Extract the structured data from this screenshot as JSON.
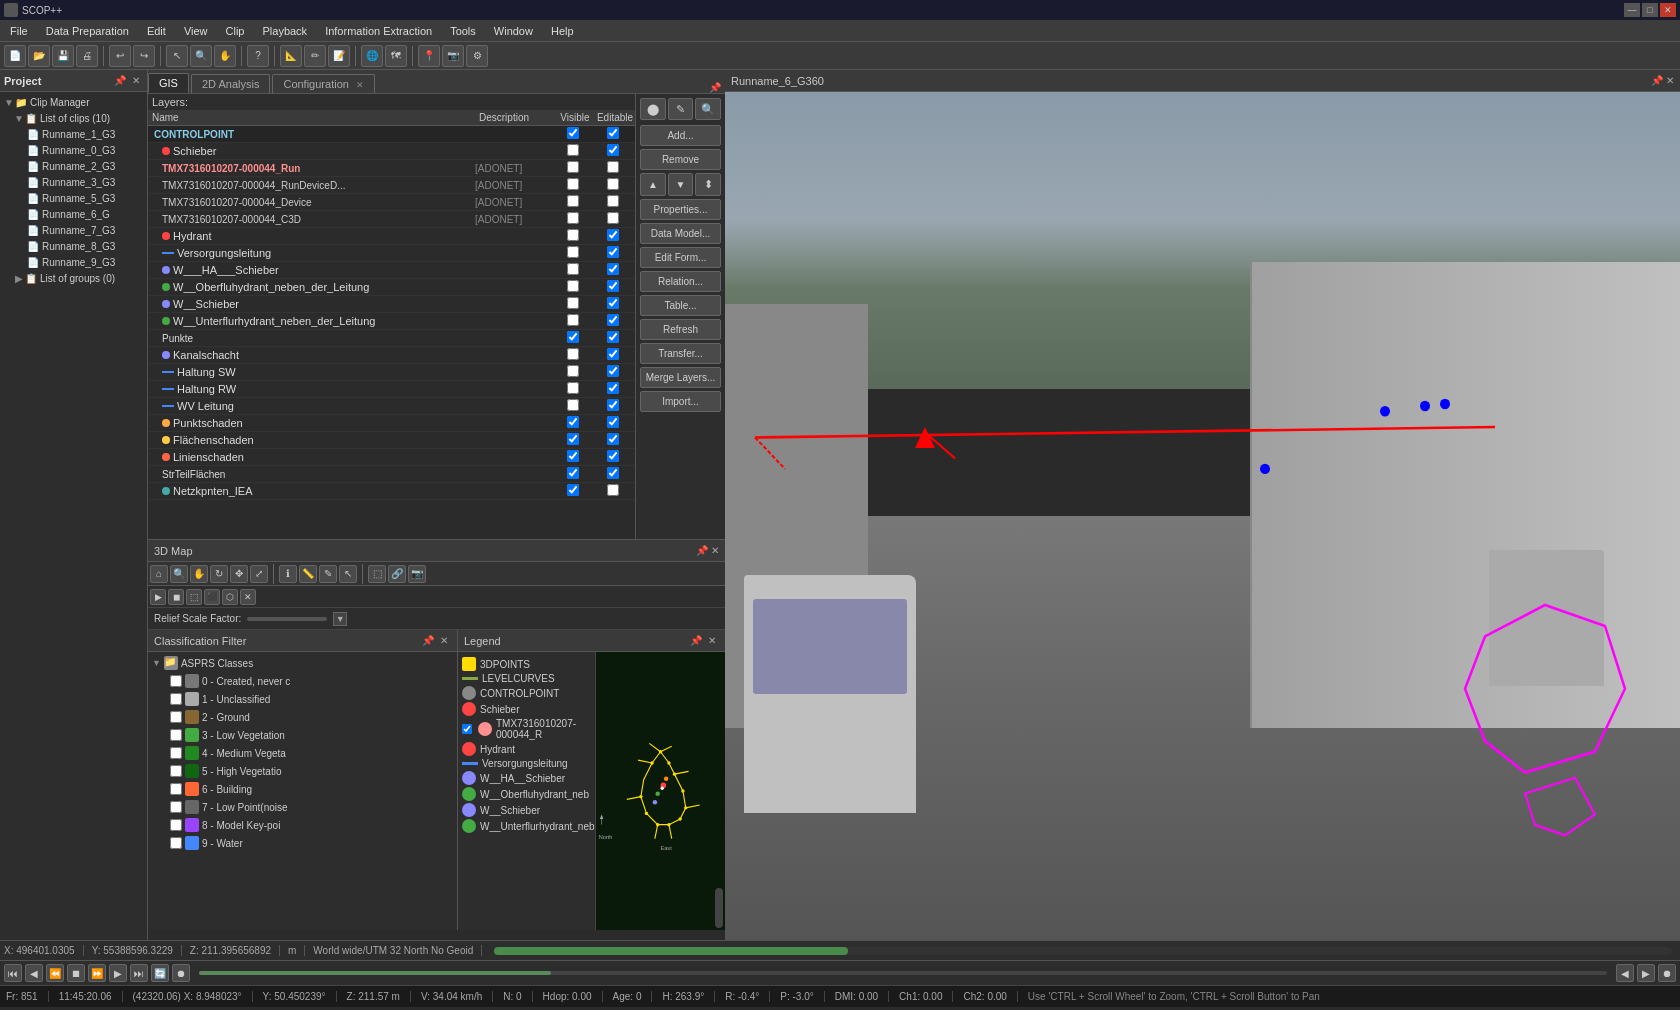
{
  "titlebar": {
    "text": "SCOP++",
    "min": "—",
    "max": "□",
    "close": "✕"
  },
  "menubar": {
    "items": [
      "File",
      "Data Preparation",
      "Edit",
      "View",
      "Clip",
      "Playback",
      "Information Extraction",
      "Tools",
      "Window",
      "Help"
    ]
  },
  "project": {
    "title": "Project",
    "clip_manager": "Clip Manager",
    "list_of_clips": "List of clips (10)",
    "clips": [
      "Runname_1_G3",
      "Runname_0_G3",
      "Runname_2_G3",
      "Runname_3_G3",
      "Runname_5_G3",
      "Runname_6_G",
      "Runname_7_G3",
      "Runname_8_G3",
      "Runname_9_G3"
    ],
    "list_of_groups": "List of groups (0)"
  },
  "gis_tabs": {
    "gis_label": "GIS",
    "analysis_label": "2D Analysis",
    "config_label": "Configuration"
  },
  "layers": {
    "header": "Layers:",
    "cols": {
      "name": "Name",
      "description": "Description",
      "visible": "Visible",
      "editable": "Editable"
    },
    "items": [
      {
        "name": "CONTROLPOINT",
        "desc": "",
        "vis": true,
        "edit": true,
        "color": null,
        "bold": true,
        "category": true
      },
      {
        "name": "Schieber",
        "desc": "",
        "vis": false,
        "edit": true,
        "color": "#ff4444",
        "type": "dot"
      },
      {
        "name": "TMX7316010207-000044_Run",
        "desc": "[ADONET]",
        "vis": false,
        "edit": false,
        "color": "#ff9090",
        "bold": true,
        "type": "bold"
      },
      {
        "name": "TMX7316010207-000044_RunDeviceD...",
        "desc": "[ADONET]",
        "vis": false,
        "edit": false,
        "type": "normal"
      },
      {
        "name": "TMX7316010207-000044_Device",
        "desc": "[ADONET]",
        "vis": false,
        "edit": false,
        "type": "normal"
      },
      {
        "name": "TMX7316010207-000044_C3D",
        "desc": "[ADONET]",
        "vis": false,
        "edit": false,
        "type": "normal"
      },
      {
        "name": "Hydrant",
        "desc": "",
        "vis": false,
        "edit": true,
        "color": "#ff4444",
        "type": "dot"
      },
      {
        "name": "Versorgungsleitung",
        "desc": "",
        "vis": false,
        "edit": true,
        "color": "#4488ff",
        "type": "line"
      },
      {
        "name": "W___HA___Schieber",
        "desc": "",
        "vis": false,
        "edit": true,
        "color": "#8888ff",
        "type": "dot"
      },
      {
        "name": "W__Oberfluhydrant_neben_der_Leitung",
        "desc": "",
        "vis": false,
        "edit": true,
        "color": "#44aa44",
        "type": "dot"
      },
      {
        "name": "W__Schieber",
        "desc": "",
        "vis": false,
        "edit": true,
        "color": "#8888ff",
        "type": "dot"
      },
      {
        "name": "W__Unterflurhydrant_neben_der_Leitung",
        "desc": "",
        "vis": false,
        "edit": true,
        "color": "#44aa44",
        "type": "dot"
      },
      {
        "name": "Punkte",
        "desc": "",
        "vis": true,
        "edit": true,
        "color": null,
        "type": "normal"
      },
      {
        "name": "Kanalschacht",
        "desc": "",
        "vis": false,
        "edit": true,
        "color": "#8888ff",
        "type": "dot"
      },
      {
        "name": "Haltung SW",
        "desc": "",
        "vis": false,
        "edit": true,
        "color": "#4488ff",
        "type": "line"
      },
      {
        "name": "Haltung RW",
        "desc": "",
        "vis": false,
        "edit": true,
        "color": "#4488ff",
        "type": "line"
      },
      {
        "name": "WV Leitung",
        "desc": "",
        "vis": false,
        "edit": true,
        "color": "#4488ff",
        "type": "line"
      },
      {
        "name": "Punktschaden",
        "desc": "",
        "vis": true,
        "edit": true,
        "color": "#ff8844",
        "type": "dot"
      },
      {
        "name": "Flächenschaden",
        "desc": "",
        "vis": true,
        "edit": true,
        "color": "#ffaa44",
        "type": "dot"
      },
      {
        "name": "Linienschaden",
        "desc": "",
        "vis": true,
        "edit": true,
        "color": "#ff6644",
        "type": "dot"
      },
      {
        "name": "StrTeilFlächen",
        "desc": "",
        "vis": true,
        "edit": true,
        "type": "normal"
      },
      {
        "name": "Netzkpnten_IEA",
        "desc": "",
        "vis": true,
        "edit": false,
        "color": "#44aaaa",
        "type": "dot"
      }
    ]
  },
  "gis_sidebar_buttons": {
    "add": "Add...",
    "remove": "Remove",
    "up": "▲",
    "down": "▼",
    "properties": "Properties...",
    "data_model": "Data Model...",
    "edit_form": "Edit Form...",
    "relation": "Relation...",
    "table": "Table...",
    "refresh": "Refresh",
    "transfer": "Transfer...",
    "merge": "Merge Layers...",
    "import_btn": "Import..."
  },
  "threed_map": {
    "title": "3D Map",
    "relief_label": "Relief Scale Factor:"
  },
  "classification": {
    "title": "Classification Filter",
    "items": [
      {
        "id": "asprs",
        "label": "ASPRS Classes",
        "type": "folder"
      },
      {
        "id": "0",
        "label": "0 - Created, never c",
        "checked": false
      },
      {
        "id": "1",
        "label": "1 - Unclassified",
        "checked": false
      },
      {
        "id": "2",
        "label": "2 - Ground",
        "checked": false
      },
      {
        "id": "3",
        "label": "3 - Low Vegetation",
        "checked": false
      },
      {
        "id": "4",
        "label": "4 - Medium Vegeta",
        "checked": false
      },
      {
        "id": "5",
        "label": "5 - High Vegetatio",
        "checked": false
      },
      {
        "id": "6",
        "label": "6 - Building",
        "checked": false
      },
      {
        "id": "7",
        "label": "7 - Low Point(noise",
        "checked": false
      },
      {
        "id": "8",
        "label": "8 - Model Key-poi",
        "checked": false
      },
      {
        "id": "9",
        "label": "9 - Water",
        "checked": false
      }
    ]
  },
  "legend": {
    "title": "Legend",
    "items": [
      {
        "label": "3DPOINTS",
        "color": "#ffdd00",
        "type": "dot"
      },
      {
        "label": "LEVELCURVES",
        "color": "#88aa44",
        "type": "line"
      },
      {
        "label": "CONTROLPOINT",
        "color": "#888888",
        "type": "dot"
      },
      {
        "label": "Schieber",
        "color": "#ff4444",
        "type": "dot"
      },
      {
        "label": "TMX7316010207-000044_R",
        "color": "#ff9090",
        "type": "dot",
        "checked": true
      },
      {
        "label": "Hydrant",
        "color": "#ff4444",
        "type": "dot"
      },
      {
        "label": "Versorgungsleitung",
        "color": "#4488ff",
        "type": "line"
      },
      {
        "label": "W__HA__Schieber",
        "color": "#8888ff",
        "type": "dot"
      },
      {
        "label": "W__Oberfluhydrant_neb",
        "color": "#44aa44",
        "type": "dot"
      },
      {
        "label": "W__Schieber",
        "color": "#8888ff",
        "type": "dot"
      },
      {
        "label": "W__Unterflurhydrant_neb",
        "color": "#44aa44",
        "type": "dot"
      }
    ]
  },
  "runname_window": {
    "title": "Runname_6_G360"
  },
  "minimap": {
    "north_label": "North",
    "east_label": "East"
  },
  "statusbar": {
    "x": "X: 496401.0305",
    "y": "Y: 55388596.3229",
    "z": "Z: 211.395656892",
    "unit": "m",
    "coord_system": "World wide/UTM 32 North No Geoid"
  },
  "bottom_status": {
    "fr": "Fr: 851",
    "time": "11:45:20.06",
    "coord": "(42320.06) X: 8.948023°",
    "y_coord": "Y: 50.450239°",
    "z_val": "Z: 211.57 m",
    "speed": "V: 34.04 km/h",
    "n": "N: 0",
    "hdop": "Hdop: 0.00",
    "age": "Age: 0",
    "h": "H: 263.9°",
    "r": "R: -0.4°",
    "p": "P: -3.0°",
    "dmi": "DMI: 0.00",
    "ch1": "Ch1: 0.00",
    "ch2": "Ch2: 0.00",
    "hint": "Use 'CTRL + Scroll Wheel' to Zoom, 'CTRL + Scroll Button' to Pan"
  }
}
